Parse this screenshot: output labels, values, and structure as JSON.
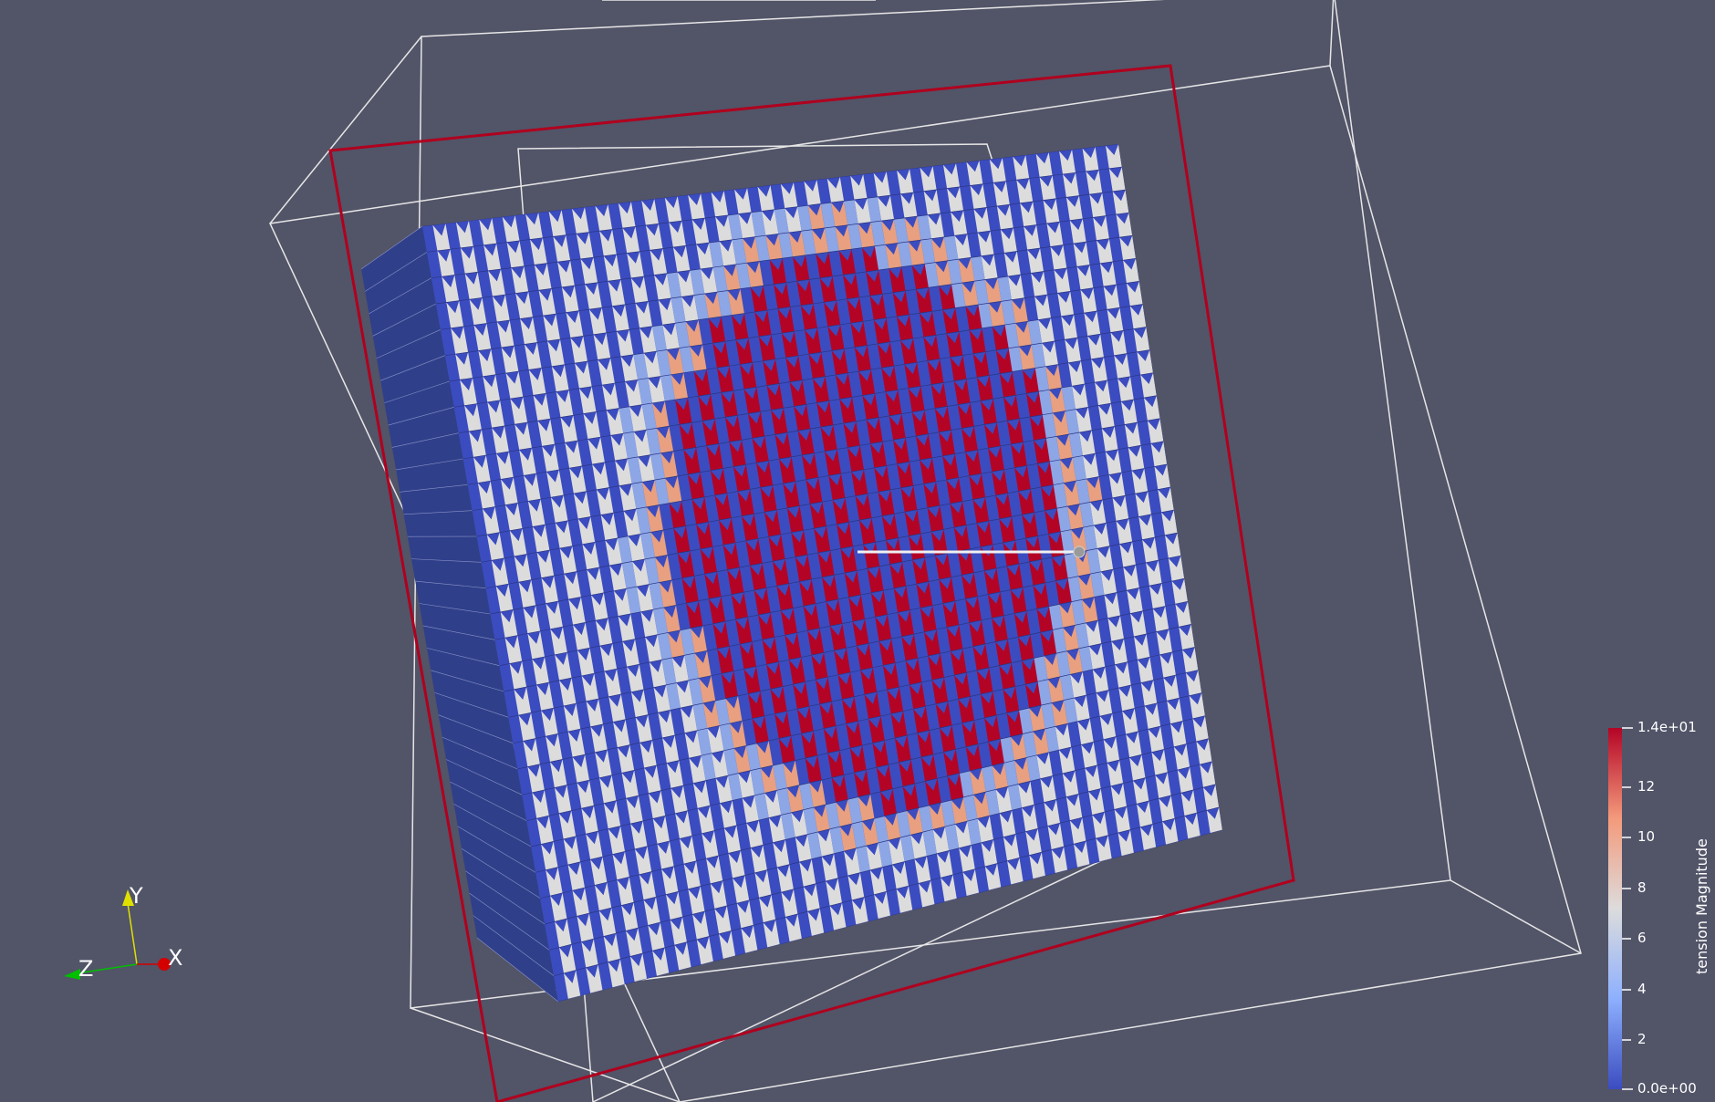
{
  "viewport": {
    "background": "#525468",
    "field_colors": {
      "low": "#3b4cc0",
      "mid": "#dddcdc",
      "high": "#b40426"
    },
    "selection_box_color": "#b0001e",
    "outline_color": "#e6e6e6",
    "grid": {
      "rows": 30,
      "cols": 30
    }
  },
  "colorbar": {
    "title": "tension Magnitude",
    "max_label": "1.4e+01",
    "min_label": "0.0e+00",
    "ticks": [
      "12",
      "10",
      "8",
      "6",
      "4",
      "2"
    ]
  },
  "orientation_axes": {
    "x_label": "X",
    "y_label": "Y",
    "z_label": "Z",
    "x_color": "#d40000",
    "y_color": "#e0e000",
    "z_color": "#00c000"
  }
}
